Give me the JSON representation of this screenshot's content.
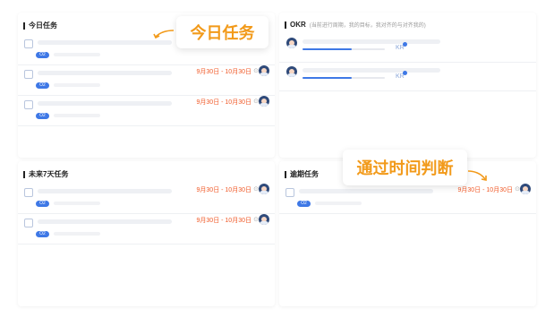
{
  "panels": {
    "today": {
      "title": "今日任务"
    },
    "okr": {
      "title": "OKR",
      "subtitle": "(当前进行周期，我的目标，我对齐的与对齐我的)"
    },
    "next7": {
      "title": "未来7天任务"
    },
    "overdue": {
      "title": "逾期任务"
    }
  },
  "today_rows": [
    {
      "tag": "O2",
      "date": "",
      "clock": ""
    },
    {
      "tag": "O2",
      "date": "9月30日 - 10月30日",
      "clock": "⊙"
    },
    {
      "tag": "O2",
      "date": "9月30日 - 10月30日",
      "clock": "⊙"
    }
  ],
  "okr_rows": [
    {
      "kr": "KR",
      "progress": 0.6
    },
    {
      "kr": "KR",
      "progress": 0.6
    }
  ],
  "next7_rows": [
    {
      "tag": "O2",
      "date": "9月30日 - 10月30日",
      "clock": "⊙"
    },
    {
      "tag": "O2",
      "date": "9月30日 - 10月30日",
      "clock": "⊙"
    }
  ],
  "overdue_rows": [
    {
      "tag": "O2",
      "date": "9月30日 - 10月30日",
      "clock": "⊙"
    }
  ],
  "callouts": {
    "today": "今日任务",
    "time": "通过时间判断"
  },
  "colors": {
    "accent": "#3e78e6",
    "date": "#f05a28",
    "callout": "#f29a1a"
  }
}
